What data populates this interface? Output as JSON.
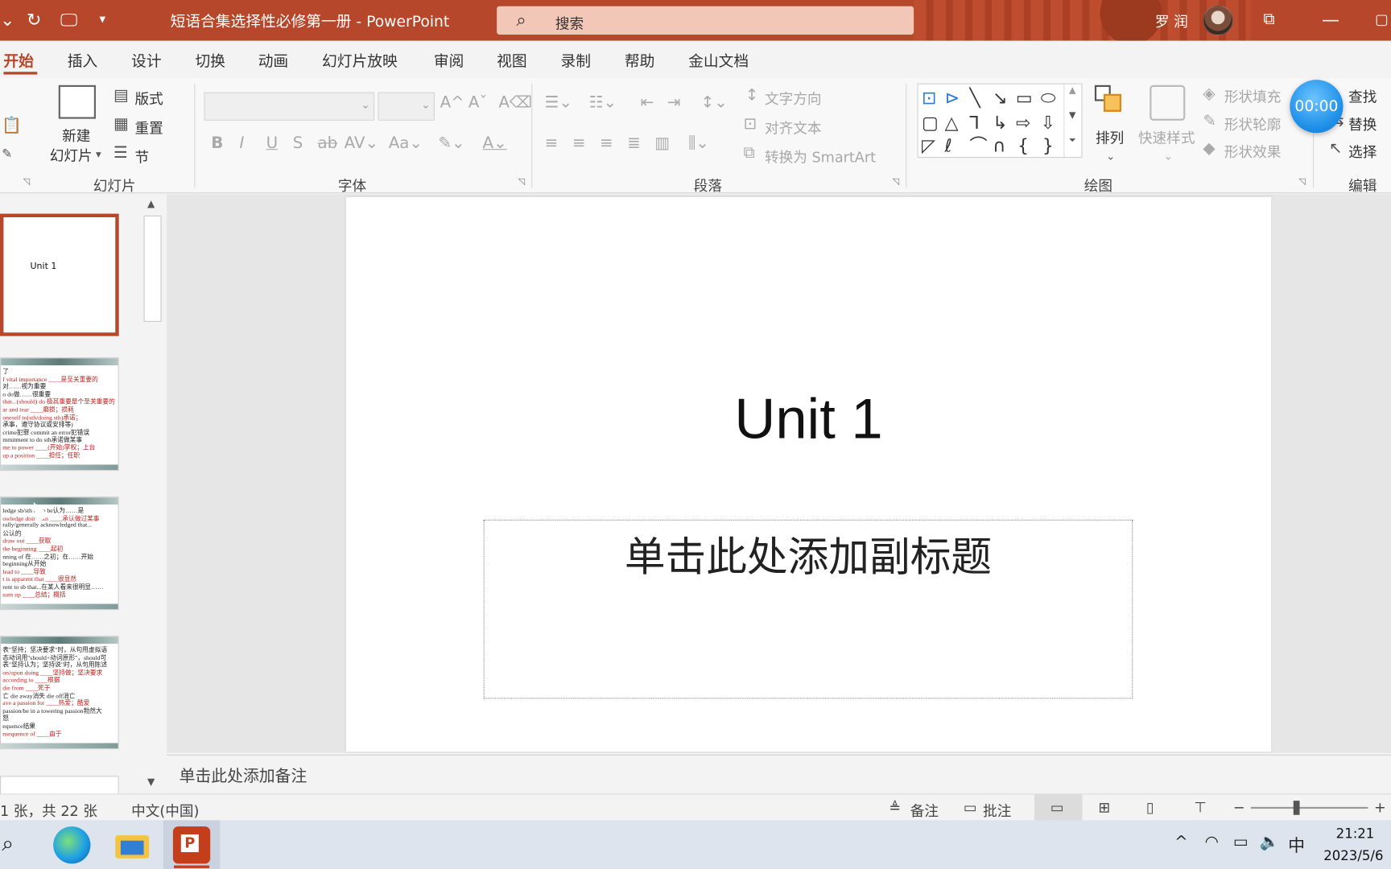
{
  "titlebar": {
    "doc_title": "短语合集选择性必修第一册  -  PowerPoint",
    "search_placeholder": "搜索",
    "user_name": "罗 润"
  },
  "tabs": [
    "开始",
    "插入",
    "设计",
    "切换",
    "动画",
    "幻灯片放映",
    "审阅",
    "视图",
    "录制",
    "帮助",
    "金山文档"
  ],
  "active_tab": "开始",
  "ribbon": {
    "slides": {
      "label": "幻灯片",
      "new_slide_1": "新建",
      "new_slide_2": "幻灯片",
      "layout": "版式",
      "reset": "重置",
      "section": "节"
    },
    "font": {
      "label": "字体"
    },
    "paragraph": {
      "label": "段落",
      "text_direction": "文字方向",
      "align_text": "对齐文本",
      "convert_smartart": "转换为 SmartArt"
    },
    "drawing": {
      "label": "绘图",
      "arrange": "排列",
      "quick_styles": "快速样式",
      "shape_fill": "形状填充",
      "shape_outline": "形状轮廓",
      "shape_effects": "形状效果"
    },
    "editing": {
      "label": "编辑",
      "find": "查找",
      "replace": "替换",
      "select": "选择"
    }
  },
  "timer": "00:00",
  "thumbnails": [
    {
      "title": "Unit 1",
      "selected": true
    },
    {
      "lines": [
        {
          "t": "了",
          "red": false
        },
        {
          "t": "f vital importance ____是至关重要的",
          "red": true
        },
        {
          "t": "对……视为重要",
          "red": false
        },
        {
          "t": "o do做……很重要",
          "red": false
        },
        {
          "t": "that...(should) do 极其重要是个至关重要的",
          "red": true
        },
        {
          "t": "ar and tear ____磨损；损耗",
          "red": true
        },
        {
          "t": "oneself to(sth/doing sth)承诺；",
          "red": true
        },
        {
          "t": "承事，遵守协议或安排等)",
          "red": false
        },
        {
          "t": "crime犯罪   commit an error犯错误",
          "red": false
        },
        {
          "t": "mmitment to do sth承诺做某事",
          "red": false
        },
        {
          "t": "me to power ____(开始)掌权；上台",
          "red": true
        },
        {
          "t": "up a position ____担任；任职",
          "red": true
        }
      ]
    },
    {
      "lines": [
        {
          "t": "ledge sb/sth as/to be认为……是",
          "red": false
        },
        {
          "t": "owledge doing sth ____承认做过某事",
          "red": true
        },
        {
          "t": "rally/generally acknowledged that...",
          "red": false
        },
        {
          "t": "公认的",
          "red": false
        },
        {
          "t": "draw out ____获取",
          "red": true
        },
        {
          "t": "the beginning ____起初",
          "red": true
        },
        {
          "t": "nning of 在……之初；在……开始",
          "red": false
        },
        {
          "t": "beginning从开始",
          "red": false
        },
        {
          "t": "lead to ____导致",
          "red": true
        },
        {
          "t": "t is apparent that ____很显然",
          "red": true
        },
        {
          "t": "rent to sb that...在某人看来很明显……",
          "red": false
        },
        {
          "t": "sum up ____总结；概括",
          "red": true
        }
      ]
    },
    {
      "lines": [
        {
          "t": "表\"坚持；坚决要求\"时，从句用虚拟语",
          "red": false
        },
        {
          "t": "态动词用\"should+动词原形\"，should可",
          "red": false
        },
        {
          "t": "表\"坚持认为；坚持说\"时，从句用陈述",
          "red": false
        },
        {
          "t": " on/upon doing ____坚持做；坚决要求",
          "red": true
        },
        {
          "t": "according to ____根据",
          "red": true
        },
        {
          "t": "die from ____死于",
          "red": true
        },
        {
          "t": "亡     die away消失    die off消亡",
          "red": false
        },
        {
          "t": "ave a passion for ____热爱；酷爱",
          "red": true
        },
        {
          "t": "passion/be in a towering passion勃然大",
          "red": false
        },
        {
          "t": "怒",
          "red": false
        },
        {
          "t": "equence结果",
          "red": false
        },
        {
          "t": "nsequence of ____由于",
          "red": true
        }
      ]
    }
  ],
  "slide": {
    "title": "Unit 1",
    "subtitle": "单击此处添加副标题"
  },
  "notes_placeholder": "单击此处添加备注",
  "statusbar": {
    "slide_counter": "1 张，共 22 张",
    "language": "中文(中国)",
    "notes": "备注",
    "comments": "批注"
  },
  "taskbar": {
    "time": "21:21",
    "date": "2023/5/6",
    "ime": "中"
  }
}
